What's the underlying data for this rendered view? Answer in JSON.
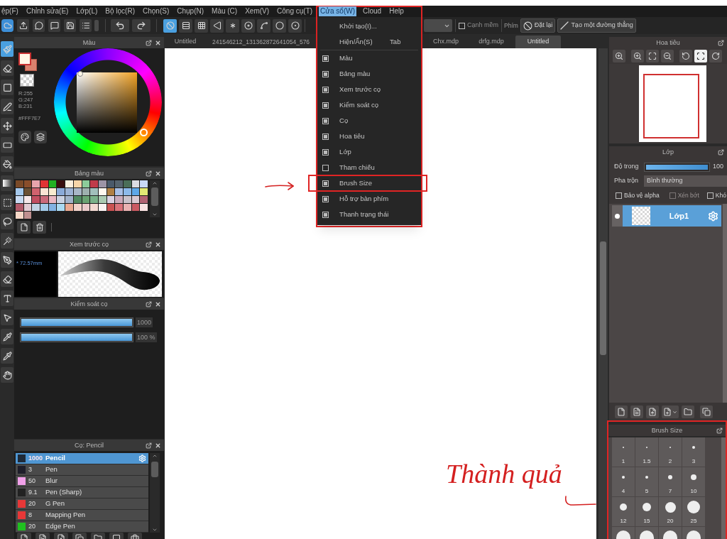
{
  "menu_bar": [
    {
      "label": "ệp(F)",
      "selected": false
    },
    {
      "label": "Chỉnh sửa(E)",
      "selected": false
    },
    {
      "label": "Lớp(L)",
      "selected": false
    },
    {
      "label": "Bộ lọc(R)",
      "selected": false
    },
    {
      "label": "Chọn(S)",
      "selected": false
    },
    {
      "label": "Chụp(N)",
      "selected": false
    },
    {
      "label": "Màu (C)",
      "selected": false
    },
    {
      "label": "Xem(V)",
      "selected": false
    },
    {
      "label": "Công cụ(T)",
      "selected": false
    },
    {
      "label": "Cửa sổ(W)",
      "selected": true
    },
    {
      "label": "Cloud",
      "selected": false
    },
    {
      "label": "Help",
      "selected": false
    }
  ],
  "window_menu": {
    "outlined": true,
    "items": [
      {
        "kind": "command",
        "label": "Khởi tạo(I)...",
        "outlined": false
      },
      {
        "kind": "command",
        "label": "Hiện/Ẩn(S)",
        "shortcut": "Tab",
        "outlined": false
      },
      {
        "kind": "toggle",
        "label": "Màu",
        "checked": true,
        "outlined": false
      },
      {
        "kind": "toggle",
        "label": "Bảng màu",
        "checked": true,
        "outlined": false
      },
      {
        "kind": "toggle",
        "label": "Xem trước cọ",
        "checked": true,
        "outlined": false
      },
      {
        "kind": "toggle",
        "label": "Kiểm soát cọ",
        "checked": true,
        "outlined": false
      },
      {
        "kind": "toggle",
        "label": "Cọ",
        "checked": true,
        "outlined": false
      },
      {
        "kind": "toggle",
        "label": "Hoa tiêu",
        "checked": true,
        "outlined": false
      },
      {
        "kind": "toggle",
        "label": "Lớp",
        "checked": true,
        "outlined": false
      },
      {
        "kind": "toggle",
        "label": "Tham chiếu",
        "checked": false,
        "outlined": false
      },
      {
        "kind": "toggle",
        "label": "Brush Size",
        "checked": true,
        "outlined": true
      },
      {
        "kind": "toggle",
        "label": "Hỗ trợ bàn phím",
        "checked": true,
        "outlined": false
      },
      {
        "kind": "toggle",
        "label": "Thanh trạng thái",
        "checked": true,
        "outlined": false
      }
    ]
  },
  "toolbar": {
    "brush_modes": [
      {
        "selected": true
      },
      {
        "selected": false
      },
      {
        "selected": false
      },
      {
        "selected": false
      },
      {
        "selected": false
      },
      {
        "selected": false
      },
      {
        "selected": false
      },
      {
        "selected": false
      },
      {
        "selected": false
      }
    ],
    "soft_edge": {
      "label": "Cạnh mềm",
      "checked": false
    },
    "key_label": "Phím",
    "buttons": [
      "Đặt lại",
      "Tạo một đường thẳng"
    ]
  },
  "tools": [
    {
      "selected": true
    },
    {
      "selected": false
    },
    {
      "selected": false
    },
    {
      "selected": false
    },
    {
      "selected": false
    },
    {
      "selected": false
    },
    {
      "selected": false
    },
    {
      "selected": false
    },
    {
      "selected": false
    },
    {
      "selected": false
    },
    {
      "selected": false
    },
    {
      "selected": false
    },
    {
      "selected": false
    },
    {
      "selected": false
    },
    {
      "selected": false
    },
    {
      "selected": false
    },
    {
      "selected": false
    },
    {
      "selected": false
    }
  ],
  "document_tabs": [
    {
      "label": "Untitled",
      "selected": false
    },
    {
      "label": "241546212_131362872641054_576",
      "selected": false
    },
    {
      "label": "Chx.mdp",
      "selected": false
    },
    {
      "label": "drfg.mdp",
      "selected": false
    },
    {
      "label": "Untitled",
      "selected": true
    }
  ],
  "color_panel": {
    "title": "Màu",
    "rgb": [
      "R:255",
      "G:247",
      "B:231"
    ],
    "hex": "#FFF7E7"
  },
  "palette_panel": {
    "title": "Bảng màu",
    "swatches": [
      {
        "color": "#7a4a28"
      },
      {
        "color": "#8a4e2a"
      },
      {
        "color": "#e8a4ac"
      },
      {
        "color": "#e03434"
      },
      {
        "color": "#22b022"
      },
      {
        "color": "#3a0e0e"
      },
      {
        "color": "#fbeedd"
      },
      {
        "color": "#f6d4a8"
      },
      {
        "color": "#8ccc9a"
      },
      {
        "color": "#c03c4a"
      },
      {
        "color": "#9c94a6"
      },
      {
        "color": "#4a5a6a"
      },
      {
        "color": "#56646e"
      },
      {
        "color": "#4a6e58"
      },
      {
        "color": "#dcdce2"
      },
      {
        "color": "#c8d8f6"
      },
      {
        "color": "#a4c8ec"
      },
      {
        "color": "#6a5034"
      },
      {
        "color": "#d0626e"
      },
      {
        "color": "#fae4d4"
      },
      {
        "color": "#f8ecd0"
      },
      {
        "color": "#8aaad8"
      },
      {
        "color": "#9cb2d4"
      },
      {
        "color": "#a8b6c6"
      },
      {
        "color": "#9eb0ae"
      },
      {
        "color": "#a2c0bc"
      },
      {
        "color": "#fff8f0"
      },
      {
        "color": "#b08044"
      },
      {
        "color": "#a8c0e6"
      },
      {
        "color": "#8cbaea"
      },
      {
        "color": "#5ea8e8"
      },
      {
        "color": "#e2e874"
      },
      {
        "color": "#c8daf2"
      },
      {
        "color": "#f6e6e8"
      },
      {
        "color": "#c24e60"
      },
      {
        "color": "#ca6a7a"
      },
      {
        "color": "#eab8c2"
      },
      {
        "color": "#cad2e2"
      },
      {
        "color": "#a2b2ca"
      },
      {
        "color": "#528a62"
      },
      {
        "color": "#6aa272"
      },
      {
        "color": "#7ab28a"
      },
      {
        "color": "#aacab2"
      },
      {
        "color": "#dad2e2"
      },
      {
        "color": "#caaaba"
      },
      {
        "color": "#cac2ca"
      },
      {
        "color": "#dacad2"
      },
      {
        "color": "#b26272"
      },
      {
        "color": "#b25a6a"
      },
      {
        "color": "#e2cad2"
      },
      {
        "color": "#c2d2e2"
      },
      {
        "color": "#a2cae8"
      },
      {
        "color": "#82b2e2"
      },
      {
        "color": "#aadaf2"
      },
      {
        "color": "#eaaa92"
      },
      {
        "color": "#f2d2ca"
      },
      {
        "color": "#eacaca"
      },
      {
        "color": "#f2dad2"
      },
      {
        "color": "#faf2f2"
      },
      {
        "color": "#ca5252"
      },
      {
        "color": "#da727a"
      },
      {
        "color": "#eab2b2"
      },
      {
        "color": "#ca5a62"
      },
      {
        "color": "#fae2e2"
      },
      {
        "color": "#f8d8c8"
      },
      {
        "color": "#c09090"
      }
    ]
  },
  "brush_preview_panel": {
    "title": "Xem trước cọ",
    "size": "* 72.57mm"
  },
  "brush_control_panel": {
    "title": "Kiểm soát cọ",
    "sliders": [
      {
        "level": 1,
        "reading": "1000"
      },
      {
        "level": 1,
        "reading": "100 %"
      }
    ]
  },
  "brush_panel": {
    "title": "Cọ: Pencil",
    "brushes": [
      {
        "size": "1000",
        "name": "Pencil",
        "color": "#1f2a38",
        "selected": true
      },
      {
        "size": "3",
        "name": "Pen",
        "color": "#1e1e2a",
        "selected": false
      },
      {
        "size": "50",
        "name": "Blur",
        "color": "#f0a0e8",
        "selected": false
      },
      {
        "size": "9.1",
        "name": "Pen (Sharp)",
        "color": "#222222",
        "selected": false
      },
      {
        "size": "20",
        "name": "G Pen",
        "color": "#e83838",
        "selected": false
      },
      {
        "size": "8",
        "name": "Mapping Pen",
        "color": "#e83838",
        "selected": false
      },
      {
        "size": "20",
        "name": "Edge Pen",
        "color": "#20c020",
        "selected": false
      }
    ]
  },
  "navigator_panel": {
    "title": "Hoa tiêu"
  },
  "layer_panel": {
    "title": "Lớp",
    "opacity": {
      "label": "Độ trong",
      "level": 1,
      "reading": "100"
    },
    "blend": {
      "label": "Pha trộn",
      "value": "Bình thường"
    },
    "options": [
      {
        "label": "Bảo vệ alpha",
        "checked": false,
        "disabled": false
      },
      {
        "label": "Xén bớt",
        "checked": false,
        "disabled": true
      },
      {
        "label": "Khó",
        "checked": false,
        "disabled": false
      }
    ],
    "layers": [
      {
        "name": "Lớp1",
        "selected": true,
        "visible": true
      }
    ]
  },
  "brush_size_panel": {
    "title": "Brush Size",
    "outlined": true,
    "sizes": [
      "1",
      "1.5",
      "2",
      "3",
      "4",
      "5",
      "7",
      "10",
      "12",
      "15",
      "20",
      "25"
    ]
  },
  "annotation": {
    "caption": "Thành quả"
  }
}
